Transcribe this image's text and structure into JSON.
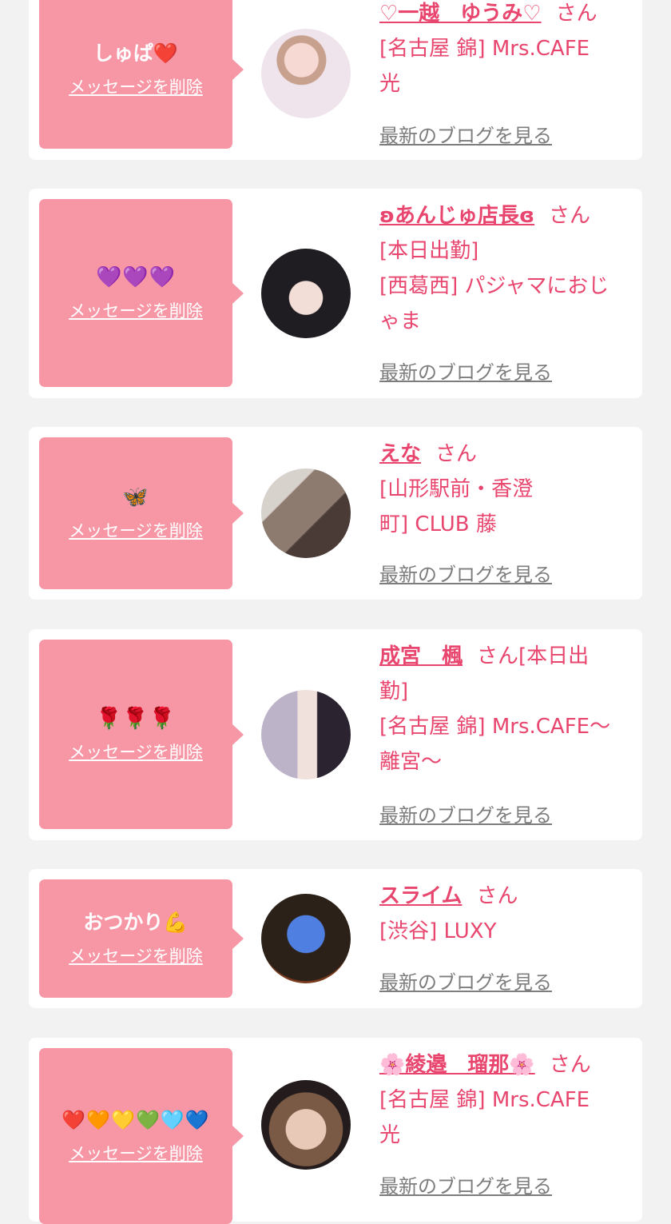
{
  "common": {
    "delete_label": "メッセージを削除",
    "blog_label": "最新のブログを見る",
    "honorific": "さん"
  },
  "entries": [
    {
      "message": "しゅぱ❤️",
      "name": "♡一越　ゆうみ♡",
      "lines": [
        "[名古屋 錦] Mrs.CAFE",
        "光"
      ]
    },
    {
      "message": "💜💜💜",
      "name": "ʚあんじゅ店長ɞ",
      "lines": [
        "[本日出勤]",
        "[西葛西] パジャマにおじ",
        "ゃま"
      ]
    },
    {
      "message": "🦋",
      "name": "えな",
      "lines": [
        "[山形駅前・香澄",
        "町] CLUB 藤"
      ]
    },
    {
      "message": "🌹🌹🌹",
      "name": "成宮　楓",
      "after_name": "[本日出",
      "lines": [
        "勤]",
        "[名古屋 錦] Mrs.CAFE～",
        "離宮～"
      ]
    },
    {
      "message": "おつかり💪",
      "name": "スライム",
      "lines": [
        "[渋谷] LUXY"
      ]
    },
    {
      "message": "❤️🧡💛💚🩵💙",
      "name": "🌸綾邉　瑠那🌸",
      "lines": [
        "[名古屋 錦] Mrs.CAFE",
        "光"
      ]
    }
  ],
  "colors": {
    "bubble": "#f797a6",
    "name_text": "#e8466e",
    "blog_link": "#7d7d7d",
    "page_bg": "#f2f2f2"
  }
}
